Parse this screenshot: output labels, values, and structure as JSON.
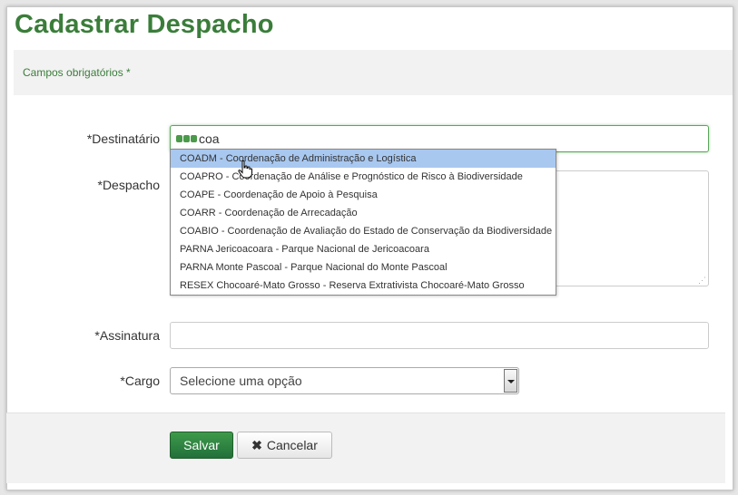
{
  "page": {
    "title": "Cadastrar Despacho",
    "required_note": "Campos obrigatórios *"
  },
  "form": {
    "destinatario": {
      "label": "*Destinatário",
      "value": "coa"
    },
    "despacho": {
      "label": "*Despacho",
      "value": ""
    },
    "assinatura": {
      "label": "*Assinatura",
      "value": ""
    },
    "cargo": {
      "label": "*Cargo",
      "selected": "Selecione uma opção"
    }
  },
  "autocomplete": {
    "highlighted_index": 0,
    "items": [
      {
        "label": "COADM - Coordenação de Administração e Logística"
      },
      {
        "label": "COAPRO - Coordenação de Análise e Prognóstico de Risco à Biodiversidade"
      },
      {
        "label": "COAPE - Coordenação de Apoio à Pesquisa"
      },
      {
        "label": "COARR - Coordenação de Arrecadação"
      },
      {
        "label": "COABIO - Coordenação de Avaliação do Estado de Conservação da Biodiversidade"
      },
      {
        "label": "PARNA Jericoacoara - Parque Nacional de Jericoacoara"
      },
      {
        "label": "PARNA Monte Pascoal - Parque Nacional do Monte Pascoal"
      },
      {
        "label": "RESEX Chocoaré-Mato Grosso - Reserva Extrativista Chocoaré-Mato Grosso"
      }
    ]
  },
  "actions": {
    "save_label": "Salvar",
    "cancel_label": "Cancelar"
  },
  "icons": {
    "loading": "loading-dots-icon",
    "cancel": "times-icon",
    "select_arrow": "chevron-down-icon",
    "cursor": "hand-pointer-icon",
    "resize": "resize-handle-icon"
  },
  "colors": {
    "title": "#3a7d3a",
    "required_note": "#3a7d3a",
    "loading_dots": "#4a9a4a",
    "focus_border": "#5aa55a",
    "highlight": "#a9c8f0",
    "save_button": "#2e8540"
  }
}
